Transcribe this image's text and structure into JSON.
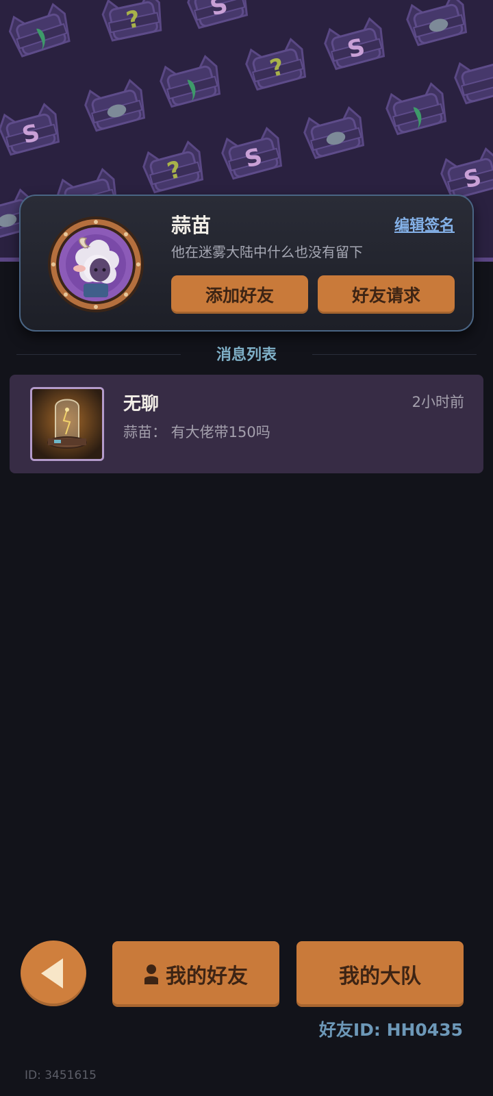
{
  "profile": {
    "name": "蒜苗",
    "edit_signature_label": "编辑签名",
    "signature": "他在迷雾大陆中什么也没有留下",
    "add_friend_label": "添加好友",
    "friend_request_label": "好友请求"
  },
  "messages": {
    "section_title": "消息列表",
    "items": [
      {
        "title": "无聊",
        "time": "2小时前",
        "preview": "蒜苗： 有大佬带150吗"
      }
    ]
  },
  "bottom_bar": {
    "my_friends_label": "我的好友",
    "my_team_label": "我的大队",
    "friend_id": "好友ID: HH0435",
    "user_id": "ID: 3451615"
  },
  "colors": {
    "accent_orange": "#c97a3a",
    "banner_purple": "#2a2140",
    "card_bg": "#22242e",
    "message_bg": "#372c45",
    "link_blue": "#84b1e8",
    "section_title": "#7fb0c7"
  }
}
